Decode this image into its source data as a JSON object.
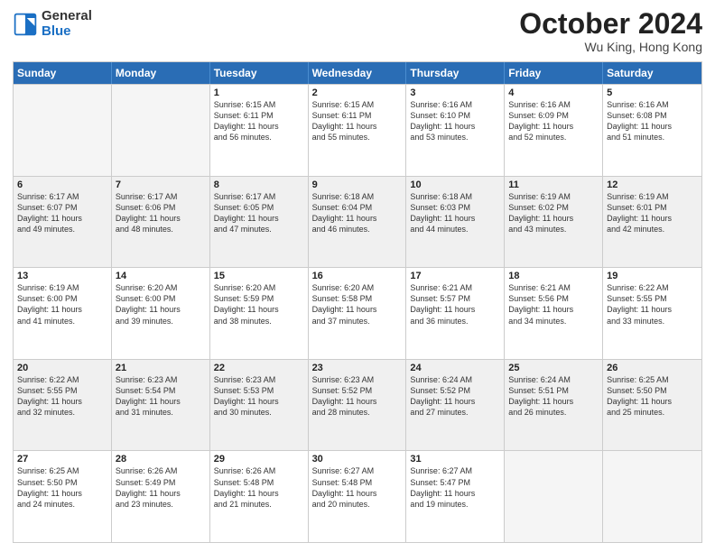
{
  "header": {
    "logo_line1": "General",
    "logo_line2": "Blue",
    "month": "October 2024",
    "location": "Wu King, Hong Kong"
  },
  "days_of_week": [
    "Sunday",
    "Monday",
    "Tuesday",
    "Wednesday",
    "Thursday",
    "Friday",
    "Saturday"
  ],
  "weeks": [
    [
      {
        "day": "",
        "info": [],
        "empty": true
      },
      {
        "day": "",
        "info": [],
        "empty": true
      },
      {
        "day": "1",
        "info": [
          "Sunrise: 6:15 AM",
          "Sunset: 6:11 PM",
          "Daylight: 11 hours",
          "and 56 minutes."
        ]
      },
      {
        "day": "2",
        "info": [
          "Sunrise: 6:15 AM",
          "Sunset: 6:11 PM",
          "Daylight: 11 hours",
          "and 55 minutes."
        ]
      },
      {
        "day": "3",
        "info": [
          "Sunrise: 6:16 AM",
          "Sunset: 6:10 PM",
          "Daylight: 11 hours",
          "and 53 minutes."
        ]
      },
      {
        "day": "4",
        "info": [
          "Sunrise: 6:16 AM",
          "Sunset: 6:09 PM",
          "Daylight: 11 hours",
          "and 52 minutes."
        ]
      },
      {
        "day": "5",
        "info": [
          "Sunrise: 6:16 AM",
          "Sunset: 6:08 PM",
          "Daylight: 11 hours",
          "and 51 minutes."
        ]
      }
    ],
    [
      {
        "day": "6",
        "info": [
          "Sunrise: 6:17 AM",
          "Sunset: 6:07 PM",
          "Daylight: 11 hours",
          "and 49 minutes."
        ]
      },
      {
        "day": "7",
        "info": [
          "Sunrise: 6:17 AM",
          "Sunset: 6:06 PM",
          "Daylight: 11 hours",
          "and 48 minutes."
        ]
      },
      {
        "day": "8",
        "info": [
          "Sunrise: 6:17 AM",
          "Sunset: 6:05 PM",
          "Daylight: 11 hours",
          "and 47 minutes."
        ]
      },
      {
        "day": "9",
        "info": [
          "Sunrise: 6:18 AM",
          "Sunset: 6:04 PM",
          "Daylight: 11 hours",
          "and 46 minutes."
        ]
      },
      {
        "day": "10",
        "info": [
          "Sunrise: 6:18 AM",
          "Sunset: 6:03 PM",
          "Daylight: 11 hours",
          "and 44 minutes."
        ]
      },
      {
        "day": "11",
        "info": [
          "Sunrise: 6:19 AM",
          "Sunset: 6:02 PM",
          "Daylight: 11 hours",
          "and 43 minutes."
        ]
      },
      {
        "day": "12",
        "info": [
          "Sunrise: 6:19 AM",
          "Sunset: 6:01 PM",
          "Daylight: 11 hours",
          "and 42 minutes."
        ]
      }
    ],
    [
      {
        "day": "13",
        "info": [
          "Sunrise: 6:19 AM",
          "Sunset: 6:00 PM",
          "Daylight: 11 hours",
          "and 41 minutes."
        ]
      },
      {
        "day": "14",
        "info": [
          "Sunrise: 6:20 AM",
          "Sunset: 6:00 PM",
          "Daylight: 11 hours",
          "and 39 minutes."
        ]
      },
      {
        "day": "15",
        "info": [
          "Sunrise: 6:20 AM",
          "Sunset: 5:59 PM",
          "Daylight: 11 hours",
          "and 38 minutes."
        ]
      },
      {
        "day": "16",
        "info": [
          "Sunrise: 6:20 AM",
          "Sunset: 5:58 PM",
          "Daylight: 11 hours",
          "and 37 minutes."
        ]
      },
      {
        "day": "17",
        "info": [
          "Sunrise: 6:21 AM",
          "Sunset: 5:57 PM",
          "Daylight: 11 hours",
          "and 36 minutes."
        ]
      },
      {
        "day": "18",
        "info": [
          "Sunrise: 6:21 AM",
          "Sunset: 5:56 PM",
          "Daylight: 11 hours",
          "and 34 minutes."
        ]
      },
      {
        "day": "19",
        "info": [
          "Sunrise: 6:22 AM",
          "Sunset: 5:55 PM",
          "Daylight: 11 hours",
          "and 33 minutes."
        ]
      }
    ],
    [
      {
        "day": "20",
        "info": [
          "Sunrise: 6:22 AM",
          "Sunset: 5:55 PM",
          "Daylight: 11 hours",
          "and 32 minutes."
        ]
      },
      {
        "day": "21",
        "info": [
          "Sunrise: 6:23 AM",
          "Sunset: 5:54 PM",
          "Daylight: 11 hours",
          "and 31 minutes."
        ]
      },
      {
        "day": "22",
        "info": [
          "Sunrise: 6:23 AM",
          "Sunset: 5:53 PM",
          "Daylight: 11 hours",
          "and 30 minutes."
        ]
      },
      {
        "day": "23",
        "info": [
          "Sunrise: 6:23 AM",
          "Sunset: 5:52 PM",
          "Daylight: 11 hours",
          "and 28 minutes."
        ]
      },
      {
        "day": "24",
        "info": [
          "Sunrise: 6:24 AM",
          "Sunset: 5:52 PM",
          "Daylight: 11 hours",
          "and 27 minutes."
        ]
      },
      {
        "day": "25",
        "info": [
          "Sunrise: 6:24 AM",
          "Sunset: 5:51 PM",
          "Daylight: 11 hours",
          "and 26 minutes."
        ]
      },
      {
        "day": "26",
        "info": [
          "Sunrise: 6:25 AM",
          "Sunset: 5:50 PM",
          "Daylight: 11 hours",
          "and 25 minutes."
        ]
      }
    ],
    [
      {
        "day": "27",
        "info": [
          "Sunrise: 6:25 AM",
          "Sunset: 5:50 PM",
          "Daylight: 11 hours",
          "and 24 minutes."
        ]
      },
      {
        "day": "28",
        "info": [
          "Sunrise: 6:26 AM",
          "Sunset: 5:49 PM",
          "Daylight: 11 hours",
          "and 23 minutes."
        ]
      },
      {
        "day": "29",
        "info": [
          "Sunrise: 6:26 AM",
          "Sunset: 5:48 PM",
          "Daylight: 11 hours",
          "and 21 minutes."
        ]
      },
      {
        "day": "30",
        "info": [
          "Sunrise: 6:27 AM",
          "Sunset: 5:48 PM",
          "Daylight: 11 hours",
          "and 20 minutes."
        ]
      },
      {
        "day": "31",
        "info": [
          "Sunrise: 6:27 AM",
          "Sunset: 5:47 PM",
          "Daylight: 11 hours",
          "and 19 minutes."
        ]
      },
      {
        "day": "",
        "info": [],
        "empty": true
      },
      {
        "day": "",
        "info": [],
        "empty": true
      }
    ]
  ]
}
